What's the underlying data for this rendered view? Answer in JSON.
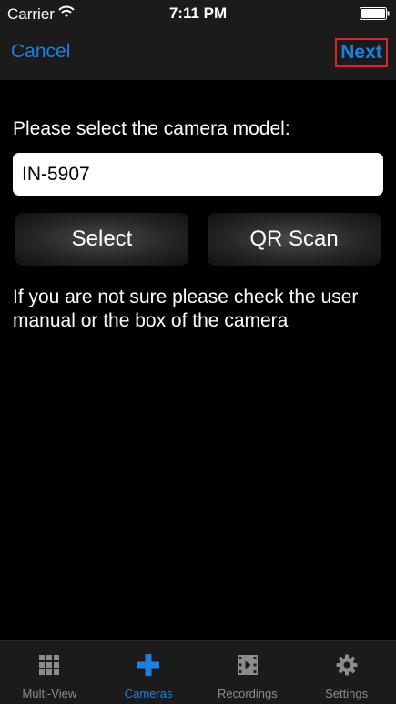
{
  "status_bar": {
    "carrier": "Carrier",
    "time": "7:11 PM",
    "icons": [
      "wifi-icon",
      "battery-icon"
    ]
  },
  "nav": {
    "cancel_label": "Cancel",
    "next_label": "Next"
  },
  "form": {
    "prompt": "Please select the camera model:",
    "model_value": "IN-5907",
    "select_label": "Select",
    "qr_label": "QR Scan",
    "help_text": "If you are not sure please check the user manual or the box of the camera"
  },
  "tabs": [
    {
      "label": "Multi-View",
      "icon": "grid-icon",
      "active": false
    },
    {
      "label": "Cameras",
      "icon": "plus-icon",
      "active": true
    },
    {
      "label": "Recordings",
      "icon": "film-icon",
      "active": false
    },
    {
      "label": "Settings",
      "icon": "gear-icon",
      "active": false
    }
  ],
  "colors": {
    "accent": "#1e7fe0",
    "highlight_border": "#d9262b",
    "bar_background": "#1b1b1b",
    "inactive_tab": "#8c8c8c"
  }
}
